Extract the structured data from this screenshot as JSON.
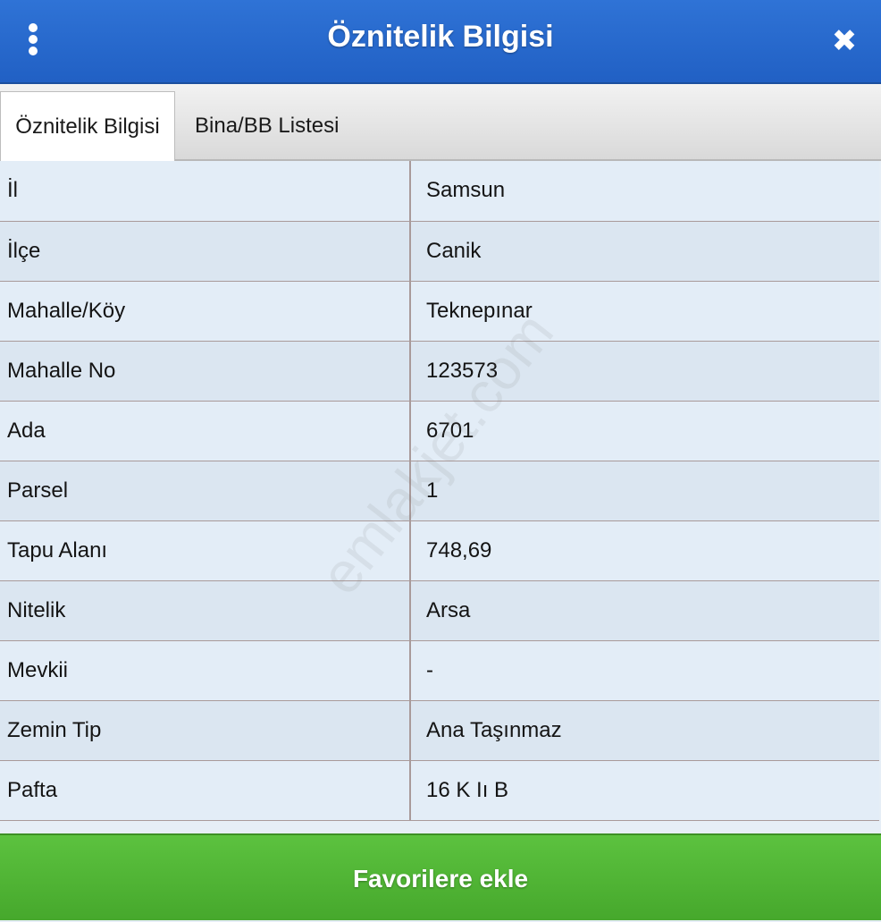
{
  "header": {
    "title": "Öznitelik Bilgisi",
    "menu_icon": "vertical-dots-icon",
    "close_icon": "close-icon",
    "close_glyph": "✖"
  },
  "tabs": [
    {
      "label": "Öznitelik Bilgisi",
      "active": true
    },
    {
      "label": "Bina/BB Listesi",
      "active": false
    }
  ],
  "attributes": [
    {
      "key": "İl",
      "value": "Samsun"
    },
    {
      "key": "İlçe",
      "value": "Canik"
    },
    {
      "key": "Mahalle/Köy",
      "value": "Teknepınar"
    },
    {
      "key": "Mahalle No",
      "value": "123573"
    },
    {
      "key": "Ada",
      "value": "6701"
    },
    {
      "key": "Parsel",
      "value": "1"
    },
    {
      "key": "Tapu Alanı",
      "value": "748,69"
    },
    {
      "key": "Nitelik",
      "value": "Arsa"
    },
    {
      "key": "Mevkii",
      "value": "-"
    },
    {
      "key": "Zemin Tip",
      "value": "Ana Taşınmaz"
    },
    {
      "key": "Pafta",
      "value": "16 K Iı B"
    }
  ],
  "footer": {
    "button_label": "Favorilere ekle"
  },
  "watermark": "emlakjet.com",
  "colors": {
    "header_blue": "#2a6ad0",
    "footer_green": "#52b636"
  }
}
